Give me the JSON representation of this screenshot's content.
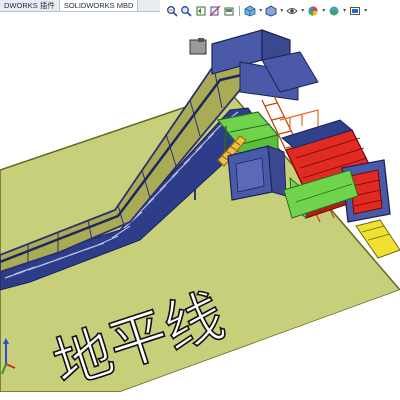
{
  "app": {
    "name": "SOLIDWORKS"
  },
  "tabs": [
    {
      "label": "DWORKS 插件",
      "active": false
    },
    {
      "label": "SOLIDWORKS MBD",
      "active": true
    }
  ],
  "heads_up_toolbar": {
    "buttons": [
      "zoom-to-fit-icon",
      "zoom-to-area-icon",
      "previous-view-icon",
      "section-view-icon",
      "dynamic-annotation-icon",
      "view-orientation-icon",
      "display-style-icon",
      "hide-show-items-icon",
      "edit-appearance-icon",
      "apply-scene-icon",
      "view-settings-icon"
    ]
  },
  "model": {
    "ground_label": "地平线",
    "colors": {
      "ground": "#c8cf7a",
      "frame": "#4b5aa8",
      "conveyor_side": "#a9ab55",
      "chain": "#9ca6c2",
      "platform": "#6fd44c",
      "ladder": "#e06a25",
      "press": "#e02a22",
      "background": "#ffffff"
    }
  }
}
